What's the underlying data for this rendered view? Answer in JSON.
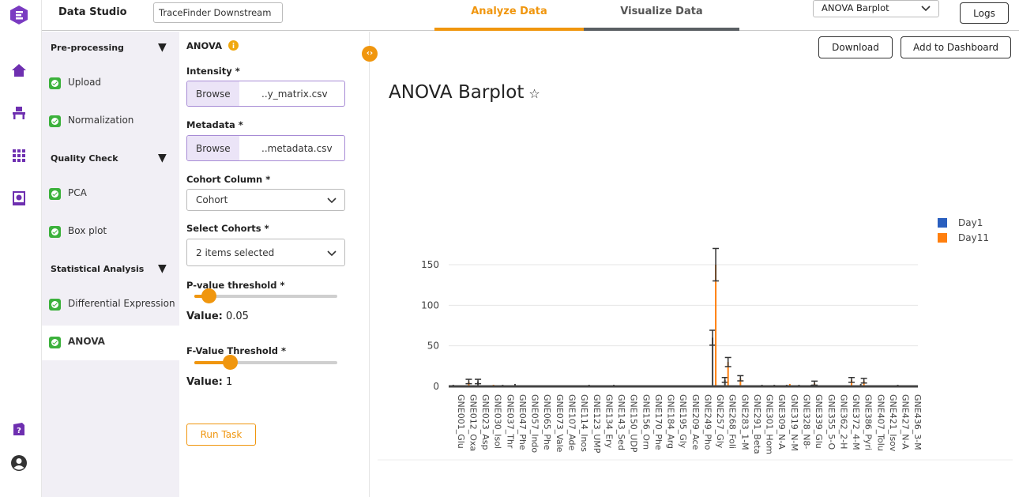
{
  "app": {
    "title": "Data Studio",
    "project": "TraceFinder Downstream"
  },
  "tabs": [
    {
      "label": "Analyze Data",
      "active": true
    },
    {
      "label": "Visualize Data",
      "active": false
    }
  ],
  "viz_select": {
    "value": "ANOVA Barplot"
  },
  "logs_label": "Logs",
  "rail_icons": [
    "logo-icon",
    "home-icon",
    "workbench-icon",
    "apps-grid-icon",
    "report-icon",
    "help-icon",
    "user-icon"
  ],
  "steps": {
    "preprocessing": {
      "title": "Pre-processing",
      "items": [
        "Upload",
        "Normalization"
      ]
    },
    "quality": {
      "title": "Quality Check",
      "items": [
        "PCA",
        "Box plot"
      ]
    },
    "stats": {
      "title": "Statistical Analysis",
      "items": [
        "Differential Expression",
        "ANOVA"
      ]
    },
    "active": "ANOVA"
  },
  "form": {
    "title": "ANOVA",
    "intensity_label": "Intensity *",
    "intensity_browse": "Browse",
    "intensity_file": "..y_matrix.csv",
    "metadata_label": "Metadata *",
    "metadata_browse": "Browse",
    "metadata_file": "..metadata.csv",
    "cohort_col_label": "Cohort Column *",
    "cohort_col_value": "Cohort",
    "cohorts_label": "Select Cohorts *",
    "cohorts_value": "2 items selected",
    "pval_label": "P-value threshold *",
    "pval_caption": "Value:",
    "pval_value": "0.05",
    "pval_fraction": 0.1,
    "fval_label": "F-Value Threshold *",
    "fval_caption": "Value:",
    "fval_value": "1",
    "fval_fraction": 0.25,
    "run_label": "Run Task"
  },
  "main": {
    "download_label": "Download",
    "dashboard_label": "Add to Dashboard",
    "chart_title": "ANOVA Barplot"
  },
  "colors": {
    "accent": "#f0960e",
    "day1": "#2a5fbf",
    "day11": "#ff7f0e",
    "bar": "#555555",
    "purple": "#6e2fb0"
  },
  "chart_data": {
    "type": "bar",
    "title": "",
    "ylabel": "",
    "xlabel": "",
    "ylim": [
      0,
      160
    ],
    "yticks": [
      0,
      50,
      100,
      150
    ],
    "legend": "top-right",
    "categories": [
      "GNE001_Glu",
      "GNE012_Oxa",
      "GNE023_Asp",
      "GNE030_Isol",
      "GNE037_Thr",
      "GNE047_Phe",
      "GNE057_Indo",
      "GNE065_Phe",
      "GNE073_Vale",
      "GNE107_Ade",
      "GNE114_Inos",
      "GNE123_UMP",
      "GNE134_Ery",
      "GNE143_Sed",
      "GNE150_UDP",
      "GNE156_Orn",
      "GNE170_Phe",
      "GNE184_Arg",
      "GNE195_Gly",
      "GNE209_Ace",
      "GNE249_Pho",
      "GNE257_Gly",
      "GNE268_Foli",
      "GNE283_1-M",
      "GNE291_Beta",
      "GNE301_Hom",
      "GNE309_N-A",
      "GNE319_N-M",
      "GNE328_N8-",
      "GNE339_Glu",
      "GNE355_5-O",
      "GNE362_2-H",
      "GNE372_4-M",
      "GNE386_Pyri",
      "GNE407_Tolu",
      "GNE421_Isov",
      "GNE427_N-A",
      "GNE436_3-M"
    ],
    "series": [
      {
        "name": "Day1",
        "values": [
          2,
          1,
          6,
          1,
          2,
          3,
          1,
          1,
          1,
          1,
          1,
          2,
          1,
          2,
          1,
          1,
          1,
          1,
          1,
          1,
          1,
          60,
          8,
          1,
          1,
          2,
          2,
          2,
          2,
          2,
          1,
          1,
          1,
          3,
          1,
          1,
          2,
          1
        ]
      },
      {
        "name": "Day11",
        "values": [
          1,
          6,
          1,
          2,
          1,
          1,
          1,
          1,
          1,
          1,
          1,
          1,
          1,
          1,
          1,
          1,
          1,
          1,
          1,
          1,
          1,
          150,
          30,
          10,
          1,
          1,
          1,
          3,
          1,
          4,
          1,
          1,
          8,
          7,
          1,
          1,
          1,
          1
        ]
      }
    ]
  }
}
